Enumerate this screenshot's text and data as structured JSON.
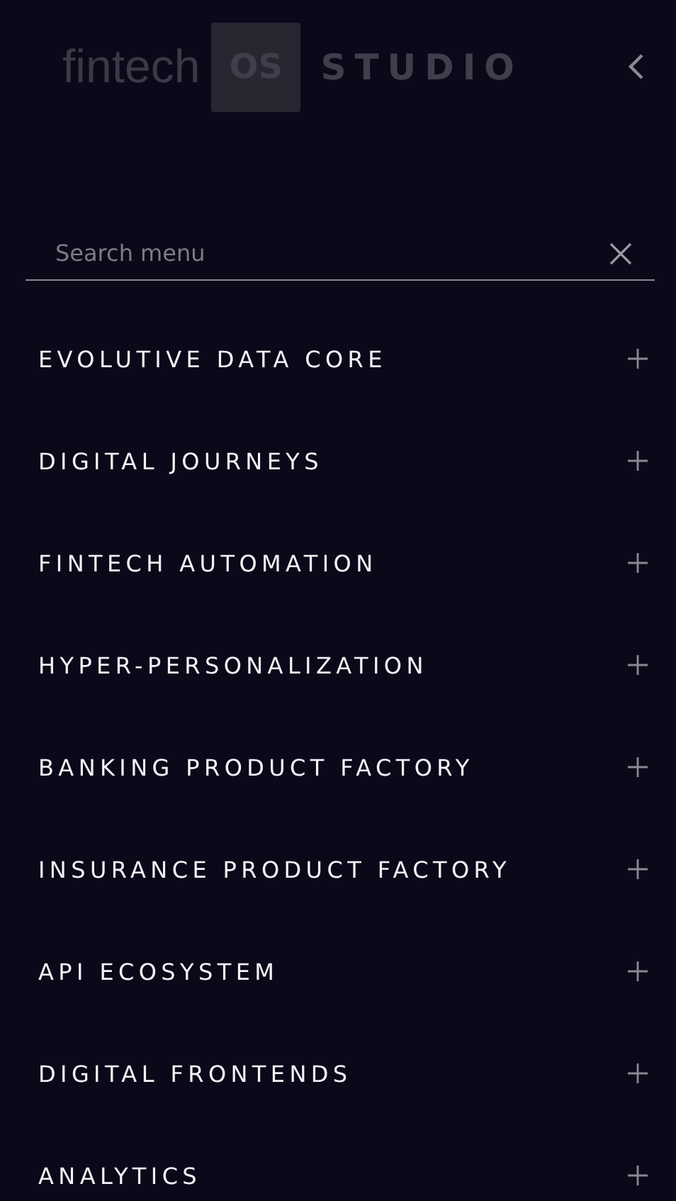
{
  "header": {
    "logo": {
      "word": "fintech",
      "badge": "OS",
      "product": "STUDIO"
    }
  },
  "search": {
    "placeholder": "Search menu"
  },
  "menu": [
    {
      "label": "EVOLUTIVE DATA CORE",
      "expanded": false
    },
    {
      "label": "DIGITAL JOURNEYS",
      "expanded": false
    },
    {
      "label": "FINTECH AUTOMATION",
      "expanded": false
    },
    {
      "label": "HYPER-PERSONALIZATION",
      "expanded": false
    },
    {
      "label": "BANKING PRODUCT FACTORY",
      "expanded": false
    },
    {
      "label": "INSURANCE PRODUCT FACTORY",
      "expanded": false
    },
    {
      "label": "API ECOSYSTEM",
      "expanded": false
    },
    {
      "label": "DIGITAL FRONTENDS",
      "expanded": false
    },
    {
      "label": "ANALYTICS",
      "expanded": false
    }
  ]
}
